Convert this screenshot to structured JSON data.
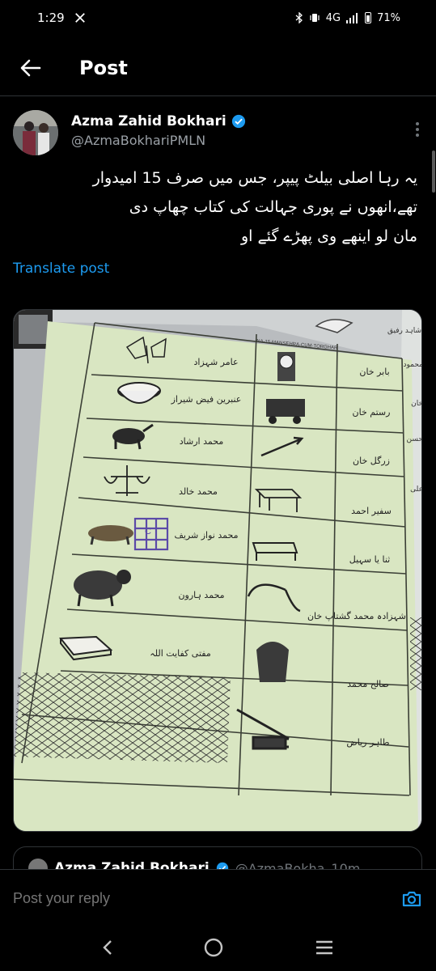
{
  "status_bar": {
    "time": "1:29",
    "notification_icon": "x-logo-icon",
    "network": "4G",
    "battery": "71%"
  },
  "nav": {
    "title": "Post"
  },
  "post": {
    "author_name": "Azma Zahid Bokhari",
    "verified": true,
    "handle": "@AzmaBokhariPMLN",
    "text_lines": [
      "یہ رہا اصلی بیلٹ پیپر، جس میں صرف 15 امیدوار",
      "تھے،انھوں نے پوری جہالت کی کتاب چھاپ دی",
      "مان لو اینھے وی پھڑے گئے او"
    ],
    "translate_label": "Translate post"
  },
  "ballot": {
    "header": "NA-15-MANSEHRA-CUM-TORGHAR",
    "left_column": [
      "عامر شہزاد",
      "عنبرین فیض شیراز",
      "محمد ارشاد",
      "محمد خالد",
      "محمد نواز شریف",
      "محمد ہارون",
      "مفتی کفایت اللہ"
    ],
    "right_column": [
      "بابر خان",
      "رستم خان",
      "زرگل خان",
      "سفیر احمد",
      "ثنا یا سہیل",
      "شہزادہ محمد گشتاپ خان",
      "صالح محمد",
      "طاہر ریاض"
    ],
    "side_labels": [
      "شاہد رفیق",
      "محمود",
      "خان",
      "حسن",
      "علی"
    ],
    "stamp_mark": "C"
  },
  "quote": {
    "author_name": "Azma Zahid Bokhari",
    "handle": "@AzmaBokha",
    "time": "10m"
  },
  "reply": {
    "placeholder": "Post your reply"
  },
  "colors": {
    "background": "#000000",
    "accent": "#1d9bf0",
    "text": "#e7e9ea",
    "muted": "#71767b",
    "ballot_paper": "#d9e6c2"
  }
}
